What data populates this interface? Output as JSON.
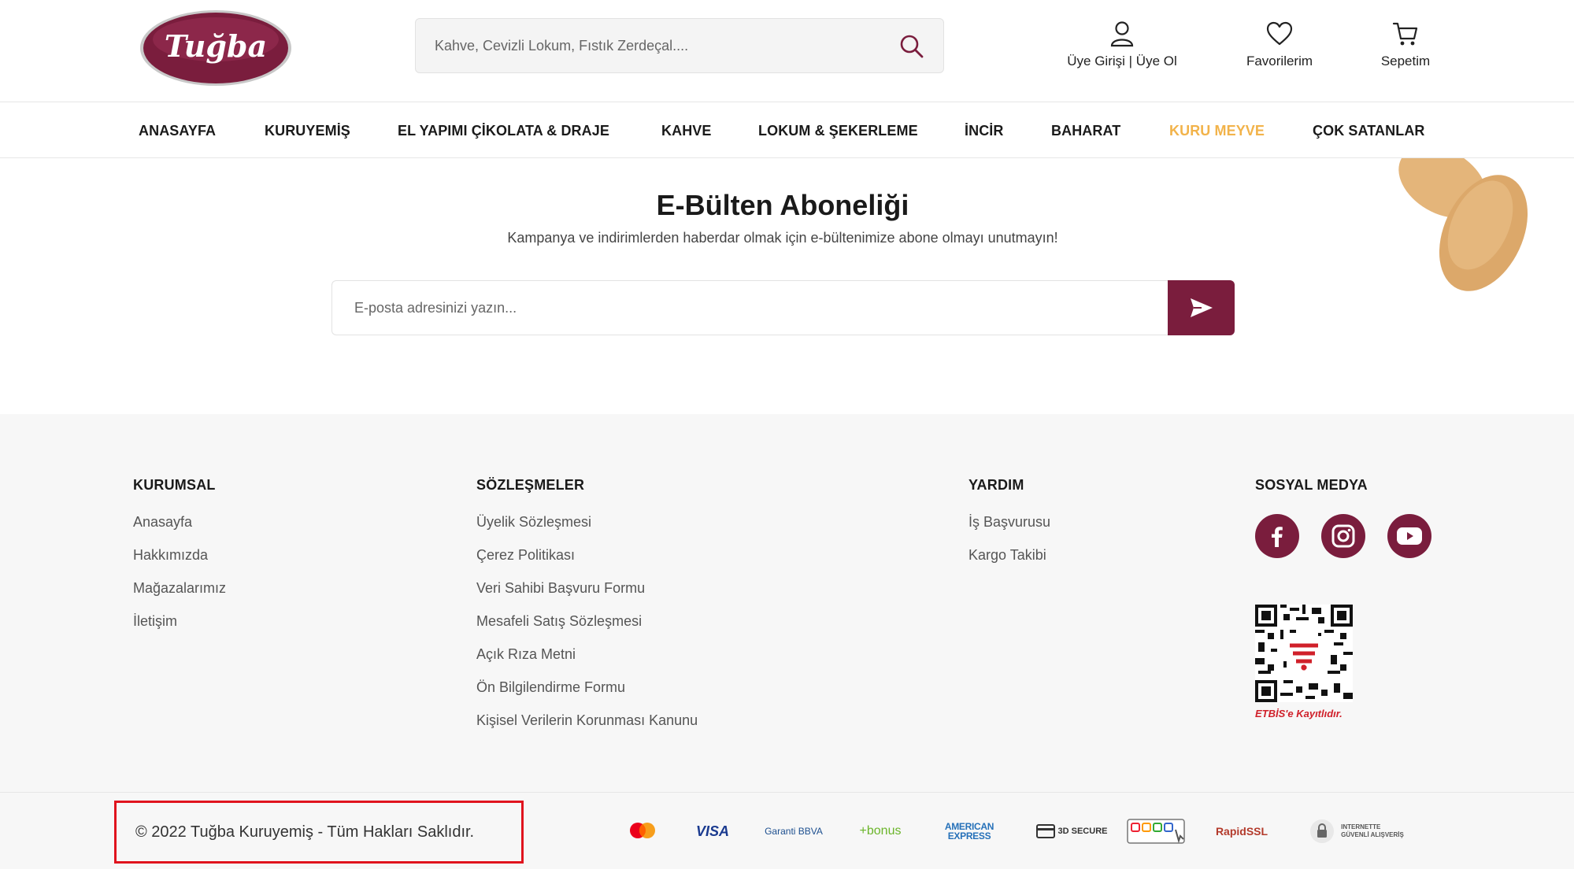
{
  "header": {
    "logo_text": "Tuğba",
    "search_placeholder": "Kahve, Cevizli Lokum, Fıstık Zerdeçal....",
    "login_label": "Üye Girişi",
    "separator": "|",
    "register_label": "Üye Ol",
    "favorites_label": "Favorilerim",
    "cart_label": "Sepetim"
  },
  "nav": {
    "items": [
      "ANASAYFA",
      "KURUYEMİŞ",
      "EL YAPIMI ÇİKOLATA & DRAJE",
      "KAHVE",
      "LOKUM & ŞEKERLEME",
      "İNCİR",
      "BAHARAT",
      "KURU MEYVE",
      "ÇOK SATANLAR"
    ],
    "active_index": 7
  },
  "newsletter": {
    "title": "E-Bülten Aboneliği",
    "subtitle": "Kampanya ve indirimlerden haberdar olmak için e-bültenimize abone olmayı unutmayın!",
    "email_placeholder": "E-posta adresinizi yazın..."
  },
  "footer": {
    "kurumsal": {
      "title": "KURUMSAL",
      "links": [
        "Anasayfa",
        "Hakkımızda",
        "Mağazalarımız",
        "İletişim"
      ]
    },
    "sozlesmeler": {
      "title": "SÖZLEŞMELER",
      "links": [
        "Üyelik Sözleşmesi",
        "Çerez Politikası",
        "Veri Sahibi Başvuru Formu",
        "Mesafeli Satış Sözleşmesi",
        "Açık Rıza Metni",
        "Ön Bilgilendirme Formu",
        "Kişisel Verilerin Korunması Kanunu"
      ]
    },
    "yardim": {
      "title": "YARDIM",
      "links": [
        "İş Başvurusu",
        "Kargo Takibi"
      ]
    },
    "sosyal": {
      "title": "SOSYAL MEDYA",
      "icons": [
        "facebook-icon",
        "instagram-icon",
        "youtube-icon"
      ],
      "etbis_caption": "ETBİS'e Kayıtlıdır."
    },
    "copyright": "© 2022 Tuğba Kuruyemiş - Tüm Hakları Saklıdır.",
    "payment": {
      "visa": "VISA",
      "garanti": "Garanti BBVA",
      "bonus": "+bonus",
      "amex_1": "AMERICAN",
      "amex_2": "EXPRESS",
      "secure_3d": "3D SECURE",
      "rapidssl": "RapidSSL",
      "guvenli_1": "INTERNETTE",
      "guvenli_2": "GÜVENLİ ALIŞVERİŞ"
    }
  },
  "colors": {
    "brand": "#7a1d3d",
    "active_nav": "#f2b34a",
    "highlight_border": "#e0141e"
  }
}
